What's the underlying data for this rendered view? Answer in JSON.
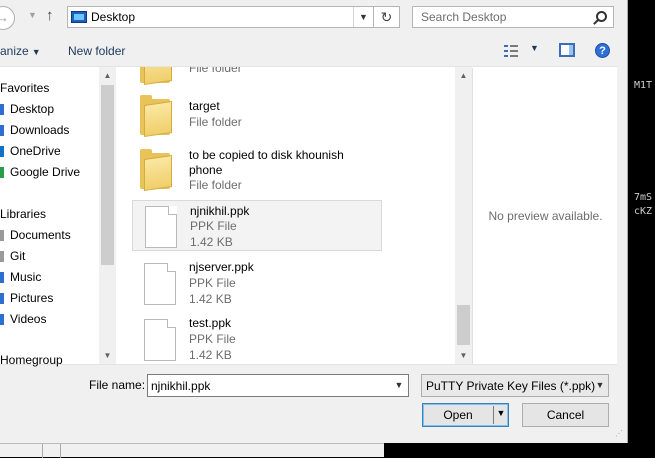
{
  "address": {
    "location": "Desktop"
  },
  "search": {
    "placeholder": "Search Desktop"
  },
  "toolbar": {
    "organize_label": "anize",
    "new_folder_label": "New folder"
  },
  "sidebar": {
    "items": [
      {
        "label": "Favorites",
        "icon": "star-icon"
      },
      {
        "label": "Desktop",
        "icon": "desktop-icon"
      },
      {
        "label": "Downloads",
        "icon": "downloads-icon"
      },
      {
        "label": "OneDrive",
        "icon": "onedrive-icon"
      },
      {
        "label": "Google Drive",
        "icon": "google-drive-icon"
      },
      {
        "label": "Libraries",
        "icon": "library-icon"
      },
      {
        "label": "Documents",
        "icon": "documents-icon"
      },
      {
        "label": "Git",
        "icon": "git-icon"
      },
      {
        "label": "Music",
        "icon": "music-icon"
      },
      {
        "label": "Pictures",
        "icon": "pictures-icon"
      },
      {
        "label": "Videos",
        "icon": "videos-icon"
      },
      {
        "label": "Homegroup",
        "icon": "homegroup-icon"
      }
    ]
  },
  "files": [
    {
      "name": "",
      "type": "File folder",
      "size": ""
    },
    {
      "name": "target",
      "type": "File folder",
      "size": ""
    },
    {
      "name": "to be copied to disk khounish",
      "name2": "phone",
      "type": "File folder",
      "size": ""
    },
    {
      "name": "njnikhil.ppk",
      "type": "PPK File",
      "size": "1.42 KB"
    },
    {
      "name": "njserver.ppk",
      "type": "PPK File",
      "size": "1.42 KB"
    },
    {
      "name": "test.ppk",
      "type": "PPK File",
      "size": "1.42 KB"
    }
  ],
  "preview": {
    "text": "No preview available."
  },
  "form": {
    "file_name_label": "File name:",
    "file_name_value": "njnikhil.ppk",
    "file_type": "PuTTY Private Key Files (*.ppk)",
    "open_label": "Open",
    "cancel_label": "Cancel"
  },
  "background_terminal": {
    "line1": "M1T",
    "line2": "7mS",
    "line3": "cKZ"
  },
  "colors": {
    "accent": "#3c7fb1",
    "selection": "#f3f3f3",
    "link": "#1e395b"
  }
}
